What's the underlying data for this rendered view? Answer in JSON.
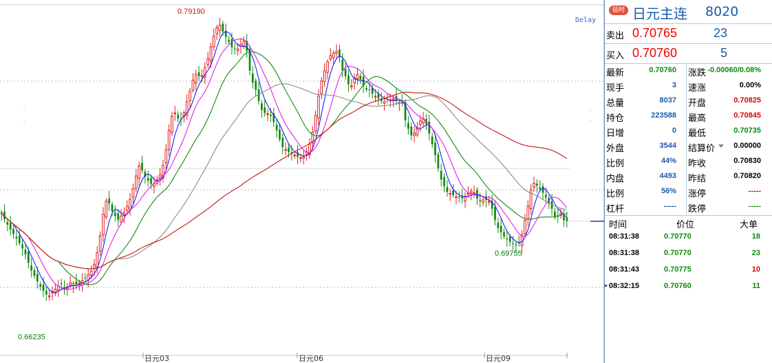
{
  "chart_data": {
    "type": "candlestick",
    "x_ticks": [
      "日元03",
      "日元06",
      "日元09"
    ],
    "y_range": [
      0.655,
      0.8
    ],
    "annotations": [
      {
        "label": "0.79190",
        "value": 0.7919
      },
      {
        "label": "0.69755",
        "value": 0.69755
      },
      {
        "label": "0.66235",
        "value": 0.66235
      }
    ],
    "closes": [
      0.7108,
      0.7085,
      0.7062,
      0.7041,
      0.7022,
      0.7004,
      0.6984,
      0.6962,
      0.6938,
      0.6902,
      0.687,
      0.6848,
      0.6825,
      0.6803,
      0.6785,
      0.677,
      0.6765,
      0.6782,
      0.6792,
      0.6805,
      0.6812,
      0.679,
      0.6802,
      0.6818,
      0.6815,
      0.6812,
      0.6818,
      0.6828,
      0.6838,
      0.6852,
      0.6868,
      0.6895,
      0.6945,
      0.7015,
      0.7105,
      0.716,
      0.715,
      0.7118,
      0.7098,
      0.7082,
      0.7098,
      0.7112,
      0.7138,
      0.7168,
      0.7212,
      0.7265,
      0.7308,
      0.7288,
      0.7262,
      0.7245,
      0.7232,
      0.7232,
      0.7248,
      0.727,
      0.731,
      0.7375,
      0.7455,
      0.7515,
      0.7528,
      0.7505,
      0.7502,
      0.753,
      0.7575,
      0.7618,
      0.7665,
      0.7688,
      0.7682,
      0.7685,
      0.7718,
      0.7755,
      0.7805,
      0.785,
      0.7885,
      0.7895,
      0.7868,
      0.7845,
      0.7825,
      0.7802,
      0.7795,
      0.7795,
      0.7815,
      0.7828,
      0.7788,
      0.7705,
      0.7655,
      0.7625,
      0.7578,
      0.754,
      0.7528,
      0.7525,
      0.7515,
      0.749,
      0.7455,
      0.7418,
      0.7385,
      0.7375,
      0.7365,
      0.7358,
      0.7352,
      0.7345,
      0.7342,
      0.7345,
      0.7365,
      0.7398,
      0.7448,
      0.7518,
      0.7598,
      0.7662,
      0.7705,
      0.7742,
      0.7768,
      0.7778,
      0.7785,
      0.7762,
      0.7705,
      0.7682,
      0.7648,
      0.7642,
      0.7675,
      0.7688,
      0.7668,
      0.7642,
      0.7625,
      0.7625,
      0.7608,
      0.7598,
      0.7588,
      0.7578,
      0.7575,
      0.7585,
      0.7582,
      0.7588,
      0.7578,
      0.7572,
      0.7568,
      0.7498,
      0.7462,
      0.7435,
      0.7445,
      0.7468,
      0.7495,
      0.7505,
      0.7482,
      0.7442,
      0.7398,
      0.7352,
      0.7298,
      0.725,
      0.7222,
      0.7198,
      0.7192,
      0.7185,
      0.7178,
      0.7175,
      0.7172,
      0.718,
      0.7192,
      0.7202,
      0.7195,
      0.717,
      0.716,
      0.7165,
      0.7165,
      0.716,
      0.7128,
      0.7082,
      0.7048,
      0.703,
      0.7012,
      0.7,
      0.699,
      0.6982,
      0.6975,
      0.6985,
      0.702,
      0.708,
      0.714,
      0.7208,
      0.7235,
      0.7225,
      0.721,
      0.7195,
      0.7175,
      0.715,
      0.7128,
      0.7095,
      0.71,
      0.711,
      0.708,
      0.7076
    ]
  },
  "delay_label": "Delay",
  "header": {
    "badge": "延时",
    "name": "日元主连",
    "code": "8020"
  },
  "quote": {
    "sell": {
      "label": "卖出",
      "price": "0.70765",
      "volume": "23"
    },
    "buy": {
      "label": "买入",
      "price": "0.70760",
      "volume": "5"
    }
  },
  "stats": {
    "left": [
      {
        "label": "最新",
        "value": "0.70760",
        "color": "#0a8a0a"
      },
      {
        "label": "现手",
        "value": "3",
        "color": "#1e5aa8"
      },
      {
        "label": "总量",
        "value": "8037",
        "color": "#1e5aa8"
      },
      {
        "label": "持仓",
        "value": "223588",
        "color": "#1e5aa8"
      },
      {
        "label": "日增",
        "value": "0",
        "color": "#1e5aa8"
      },
      {
        "label": "外盘",
        "value": "3544",
        "color": "#1e5aa8"
      },
      {
        "label": "比例",
        "value": "44%",
        "color": "#1e5aa8"
      },
      {
        "label": "内盘",
        "value": "4493",
        "color": "#1e5aa8"
      },
      {
        "label": "比例",
        "value": "56%",
        "color": "#1e5aa8"
      },
      {
        "label": "杠杆",
        "value": "-----",
        "color": "#1e5aa8"
      }
    ],
    "right": [
      {
        "label": "涨跌",
        "value": "-0.00060/0.08%",
        "color": "#0a8a0a"
      },
      {
        "label": "速涨",
        "value": "0.00%",
        "color": "#000000"
      },
      {
        "label": "开盘",
        "value": "0.70825",
        "color": "#e00000"
      },
      {
        "label": "最高",
        "value": "0.70845",
        "color": "#e00000"
      },
      {
        "label": "最低",
        "value": "0.70735",
        "color": "#0a8a0a"
      },
      {
        "label": "结算价",
        "value": "0.00000",
        "color": "#000000"
      },
      {
        "label": "昨收",
        "value": "0.70830",
        "color": "#000000"
      },
      {
        "label": "昨结",
        "value": "0.70820",
        "color": "#000000"
      },
      {
        "label": "涨停",
        "value": "-----",
        "color": "#e00000"
      },
      {
        "label": "跌停",
        "value": "-----",
        "color": "#0a8a0a"
      }
    ]
  },
  "ticks": {
    "headers": {
      "time": "时间",
      "price": "价位",
      "volume": "大单"
    },
    "rows": [
      {
        "time": "08:31:38",
        "price": "0.70770",
        "volume": "18",
        "color": "#0a8a0a"
      },
      {
        "time": "08:31:38",
        "price": "0.70770",
        "volume": "23",
        "color": "#0a8a0a"
      },
      {
        "time": "08:31:43",
        "price": "0.70775",
        "volume": "10",
        "color": "#e00000"
      },
      {
        "time": "08:32:15",
        "price": "0.70760",
        "volume": "11",
        "color": "#0a8a0a"
      }
    ]
  }
}
